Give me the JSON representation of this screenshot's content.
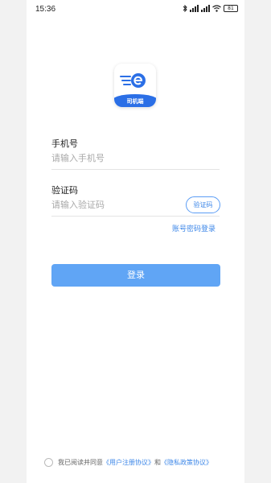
{
  "status_bar": {
    "time": "15:36",
    "battery": "81",
    "icons": [
      "bluetooth-icon",
      "signal-icon",
      "signal-icon",
      "wifi-icon",
      "battery-icon"
    ]
  },
  "logo": {
    "label": "司机端",
    "brand_color": "#2b6fe6"
  },
  "form": {
    "phone_label": "手机号",
    "phone_placeholder": "请输入手机号",
    "phone_value": "",
    "code_label": "验证码",
    "code_placeholder": "请输入验证码",
    "code_value": "",
    "get_code_label": "验证码",
    "password_login_link": "账号密码登录",
    "login_button": "登录"
  },
  "agreement": {
    "checked": false,
    "prefix": "我已阅读并同意",
    "user_agreement": "《用户注册协议》",
    "connector": "和",
    "privacy_policy": "《隐私政策协议》"
  },
  "colors": {
    "accent": "#3d87e8",
    "button": "#60a5f5",
    "background": "#ffffff"
  }
}
